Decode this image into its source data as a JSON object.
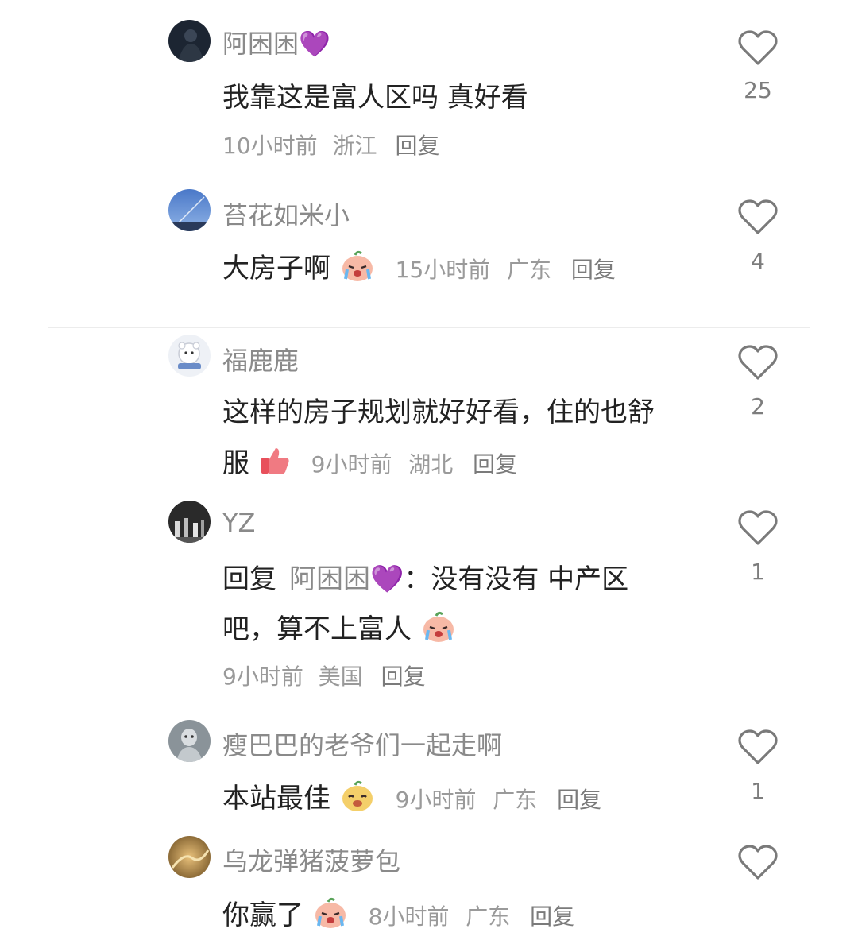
{
  "comments": [
    {
      "username": "阿困困💜",
      "text": "我靠这是富人区吗 真好看",
      "time": "10小时前",
      "location": "浙江",
      "reply_label": "回复",
      "likes": "25"
    },
    {
      "username": "苔花如米小",
      "text": "大房子啊",
      "time": "15小时前",
      "location": "广东",
      "reply_label": "回复",
      "likes": "4"
    },
    {
      "username": "福鹿鹿",
      "text_line1": "这样的房子规划就好好看，住的也舒",
      "text_line2": "服",
      "time": "9小时前",
      "location": "湖北",
      "reply_label": "回复",
      "likes": "2"
    },
    {
      "username": "YZ",
      "reply_prefix": "回复",
      "mention": "阿困困💜",
      "text_line1": "：没有没有 中产区",
      "text_line2": "吧，算不上富人",
      "time": "9小时前",
      "location": "美国",
      "reply_label": "回复",
      "likes": "1"
    },
    {
      "username": "瘦巴巴的老爷们一起走啊",
      "text": "本站最佳",
      "time": "9小时前",
      "location": "广东",
      "reply_label": "回复",
      "likes": "1"
    },
    {
      "username": "乌龙弹猪菠萝包",
      "text": "你赢了",
      "time": "8小时前",
      "location": "广东",
      "reply_label": "回复",
      "likes": ""
    }
  ],
  "icons": {
    "like": "heart-outline-icon",
    "emoji_cry": "crying-peach-emoji",
    "emoji_thumbs": "thumbs-up-emoji",
    "emoji_smug": "smug-peach-emoji"
  },
  "colors": {
    "username": "#8a8a8a",
    "text": "#222222",
    "meta": "#9a9a9a"
  }
}
